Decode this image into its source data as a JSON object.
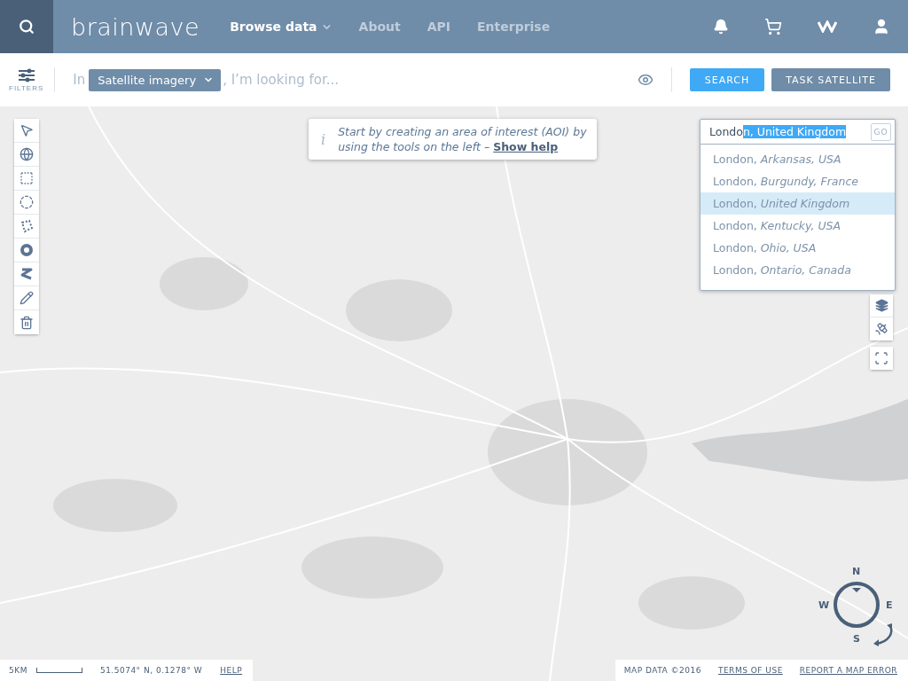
{
  "header": {
    "logo": "brainwave",
    "nav": [
      {
        "label": "Browse data",
        "selected": true,
        "dropdown": true
      },
      {
        "label": "About",
        "selected": false,
        "dropdown": false
      },
      {
        "label": "API",
        "selected": false,
        "dropdown": false
      },
      {
        "label": "Enterprise",
        "selected": false,
        "dropdown": false
      }
    ]
  },
  "filter_bar": {
    "filters_label": "FILTERS",
    "prefix": "In",
    "source": "Satellite imagery",
    "placeholder": ", I’m looking for...",
    "search_button": "SEARCH",
    "task_button": "TASK SATELLITE"
  },
  "info_banner": {
    "icon": "i",
    "text": "Start by creating an area of interest (AOI) by using the tools on the left –",
    "link": "Show help"
  },
  "location_search": {
    "typed": "Londo",
    "completion": "n, United Kingdom",
    "button": "GO",
    "suggestions": [
      {
        "city": "London,",
        "region": "Arkansas, USA",
        "selected": false
      },
      {
        "city": "London,",
        "region": "Burgundy, France",
        "selected": false
      },
      {
        "city": "London,",
        "region": "United Kingdom",
        "selected": true
      },
      {
        "city": "London,",
        "region": "Kentucky, USA",
        "selected": false
      },
      {
        "city": "London,",
        "region": "Ohio, USA",
        "selected": false
      },
      {
        "city": "London,",
        "region": "Ontario, Canada",
        "selected": false
      }
    ]
  },
  "compass": {
    "north": "N",
    "east": "E",
    "south": "S",
    "west": "W"
  },
  "footer_left": {
    "scale": "5KM",
    "coordinates": "51.5074° N, 0.1278° W",
    "help": "HELP"
  },
  "footer_right": {
    "map_data": "MAP DATA ©2016",
    "terms": "TERMS OF USE",
    "report": "REPORT A MAP ERROR"
  }
}
